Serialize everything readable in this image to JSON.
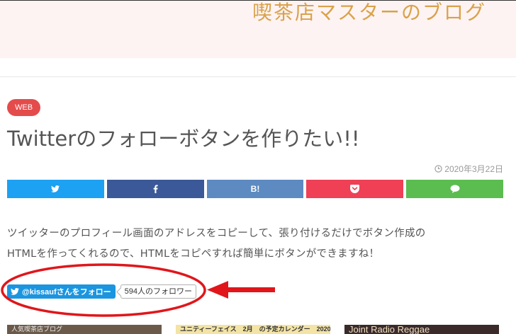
{
  "header": {
    "site_title": "喫茶店マスターのブログ"
  },
  "article": {
    "category": "WEB",
    "title": "Twitterのフォローボタンを作りたい!!",
    "date": "2020年3月22日",
    "body_lines": [
      "ツイッターのプロフィール画面のアドレスをコピーして、張り付けるだけでボタン作成の",
      "HTMLを作ってくれるので、HTMLをコピペすれば簡単にボタンができますね！"
    ]
  },
  "share_buttons": [
    {
      "name": "twitter",
      "color": "#1da1f2",
      "icon": "twitter-icon"
    },
    {
      "name": "facebook",
      "color": "#3b5998",
      "icon": "facebook-icon"
    },
    {
      "name": "hatena",
      "color": "#5d8ac1",
      "icon": "hatena-icon",
      "label": "B!"
    },
    {
      "name": "pocket",
      "color": "#ef4056",
      "icon": "pocket-icon"
    },
    {
      "name": "line",
      "color": "#5bbd4f",
      "icon": "line-icon"
    }
  ],
  "twitter_follow": {
    "button_label": "@kissaufさんをフォロー",
    "follower_count": "594人のフォロワー"
  },
  "related_thumbs": [
    {
      "caption": "人気喫茶店ブログ"
    },
    {
      "caption": "ユニティーフェイス　2月　の予定カレンダー　2020"
    },
    {
      "caption": "Joint Radio Reggae"
    }
  ],
  "colors": {
    "title_accent": "#d9a24a",
    "badge": "#e44c4c",
    "annotation_red": "#e0161b",
    "follow_blue": "#1b95e0"
  }
}
